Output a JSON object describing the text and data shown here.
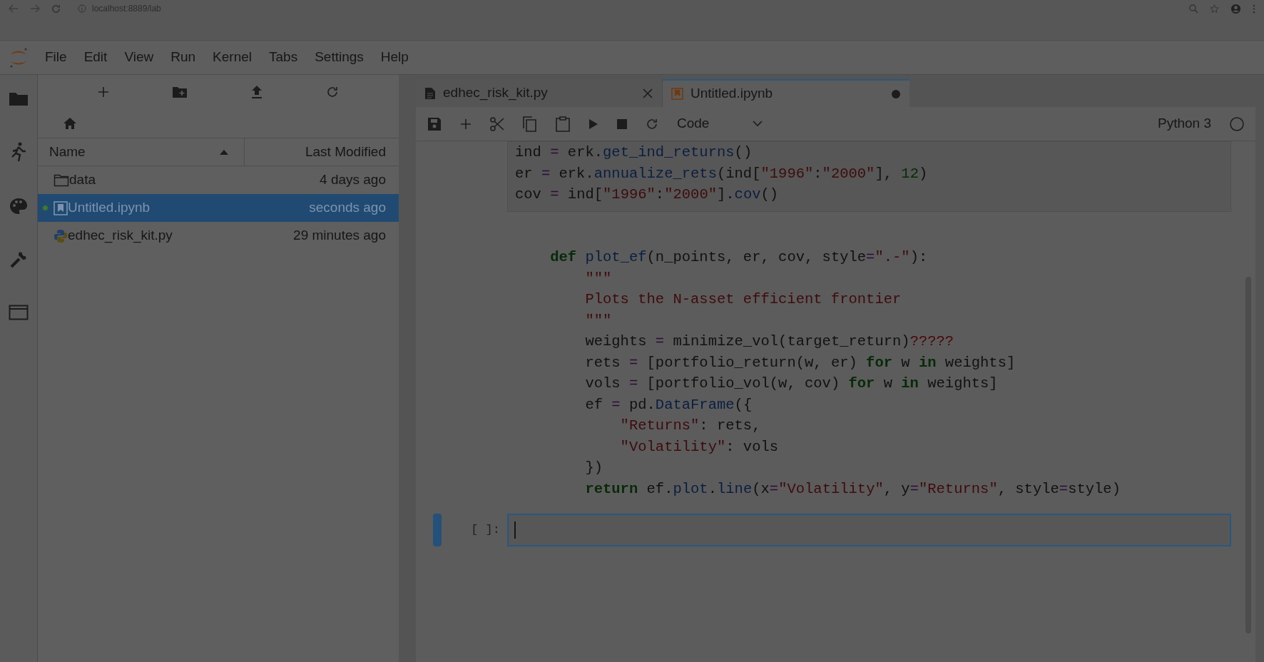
{
  "browser": {
    "url": "localhost:8889/lab"
  },
  "menu": [
    "File",
    "Edit",
    "View",
    "Run",
    "Kernel",
    "Tabs",
    "Settings",
    "Help"
  ],
  "file_browser": {
    "columns": [
      {
        "label": "Name",
        "sorted": true
      },
      {
        "label": "Last Modified",
        "sorted": false
      }
    ],
    "rows": [
      {
        "kind": "folder",
        "name": "data",
        "modified": "4 days ago",
        "selected": false,
        "running": false
      },
      {
        "kind": "notebook",
        "name": "Untitled.ipynb",
        "modified": "seconds ago",
        "selected": true,
        "running": true
      },
      {
        "kind": "python",
        "name": "edhec_risk_kit.py",
        "modified": "29 minutes ago",
        "selected": false,
        "running": false
      }
    ]
  },
  "tabs": [
    {
      "kind": "file",
      "label": "edhec_risk_kit.py",
      "selected": false,
      "dirty": false
    },
    {
      "kind": "notebook",
      "label": "Untitled.ipynb",
      "selected": true,
      "dirty": true
    }
  ],
  "toolbar": {
    "cell_type": "Code",
    "kernel": "Python 3"
  },
  "cells": [
    {
      "active": false,
      "lines": [
        [
          {
            "kind": "plain",
            "text": "ind "
          },
          {
            "kind": "operator",
            "text": "="
          },
          {
            "kind": "plain",
            "text": " erk."
          },
          {
            "kind": "function",
            "text": "get_ind_returns"
          },
          {
            "kind": "plain",
            "text": "()"
          }
        ],
        [
          {
            "kind": "plain",
            "text": "er "
          },
          {
            "kind": "operator",
            "text": "="
          },
          {
            "kind": "plain",
            "text": " erk."
          },
          {
            "kind": "function",
            "text": "annualize_rets"
          },
          {
            "kind": "plain",
            "text": "(ind["
          },
          {
            "kind": "string",
            "text": "\"1996\""
          },
          {
            "kind": "plain",
            "text": ":"
          },
          {
            "kind": "string",
            "text": "\"2000\""
          },
          {
            "kind": "plain",
            "text": "], "
          },
          {
            "kind": "number",
            "text": "12"
          },
          {
            "kind": "plain",
            "text": ")"
          }
        ],
        [
          {
            "kind": "plain",
            "text": "cov "
          },
          {
            "kind": "operator",
            "text": "="
          },
          {
            "kind": "plain",
            "text": " ind["
          },
          {
            "kind": "string",
            "text": "\"1996\""
          },
          {
            "kind": "plain",
            "text": ":"
          },
          {
            "kind": "string",
            "text": "\"2000\""
          },
          {
            "kind": "plain",
            "text": "]."
          },
          {
            "kind": "function",
            "text": "cov"
          },
          {
            "kind": "plain",
            "text": "()"
          }
        ]
      ]
    },
    {
      "active": false,
      "lines": [
        [
          {
            "kind": "keyword",
            "text": "    def "
          },
          {
            "kind": "function",
            "text": "plot_ef"
          },
          {
            "kind": "plain",
            "text": "(n_points, er, cov, style"
          },
          {
            "kind": "operator",
            "text": "="
          },
          {
            "kind": "string",
            "text": "\".-\""
          },
          {
            "kind": "plain",
            "text": "):"
          }
        ],
        [
          {
            "kind": "string",
            "text": "        \"\"\""
          }
        ],
        [
          {
            "kind": "string",
            "text": "        Plots the N-asset efficient frontier"
          }
        ],
        [
          {
            "kind": "string",
            "text": "        \"\"\""
          }
        ],
        [
          {
            "kind": "plain",
            "text": "        weights "
          },
          {
            "kind": "operator",
            "text": "="
          },
          {
            "kind": "plain",
            "text": " minimize_vol(target_return)"
          },
          {
            "kind": "error",
            "text": "?????"
          }
        ],
        [
          {
            "kind": "plain",
            "text": "        rets "
          },
          {
            "kind": "operator",
            "text": "="
          },
          {
            "kind": "plain",
            "text": " [portfolio_return(w, er) "
          },
          {
            "kind": "keyword",
            "text": "for"
          },
          {
            "kind": "plain",
            "text": " w "
          },
          {
            "kind": "keyword",
            "text": "in"
          },
          {
            "kind": "plain",
            "text": " weights]"
          }
        ],
        [
          {
            "kind": "plain",
            "text": "        vols "
          },
          {
            "kind": "operator",
            "text": "="
          },
          {
            "kind": "plain",
            "text": " [portfolio_vol(w, cov) "
          },
          {
            "kind": "keyword",
            "text": "for"
          },
          {
            "kind": "plain",
            "text": " w "
          },
          {
            "kind": "keyword",
            "text": "in"
          },
          {
            "kind": "plain",
            "text": " weights]"
          }
        ],
        [
          {
            "kind": "plain",
            "text": "        ef "
          },
          {
            "kind": "operator",
            "text": "="
          },
          {
            "kind": "plain",
            "text": " pd."
          },
          {
            "kind": "function",
            "text": "DataFrame"
          },
          {
            "kind": "plain",
            "text": "({"
          }
        ],
        [
          {
            "kind": "string",
            "text": "            \"Returns\""
          },
          {
            "kind": "plain",
            "text": ": rets,"
          }
        ],
        [
          {
            "kind": "string",
            "text": "            \"Volatility\""
          },
          {
            "kind": "plain",
            "text": ": vols"
          }
        ],
        [
          {
            "kind": "plain",
            "text": "        })"
          }
        ],
        [
          {
            "kind": "keyword",
            "text": "        return"
          },
          {
            "kind": "plain",
            "text": " ef."
          },
          {
            "kind": "function",
            "text": "plot"
          },
          {
            "kind": "plain",
            "text": "."
          },
          {
            "kind": "function",
            "text": "line"
          },
          {
            "kind": "plain",
            "text": "(x"
          },
          {
            "kind": "operator",
            "text": "="
          },
          {
            "kind": "string",
            "text": "\"Volatility\""
          },
          {
            "kind": "plain",
            "text": ", y"
          },
          {
            "kind": "operator",
            "text": "="
          },
          {
            "kind": "string",
            "text": "\"Returns\""
          },
          {
            "kind": "plain",
            "text": ", style"
          },
          {
            "kind": "operator",
            "text": "="
          },
          {
            "kind": "plain",
            "text": "style)"
          }
        ]
      ]
    },
    {
      "prompt": "[ ]:",
      "active": true
    }
  ]
}
